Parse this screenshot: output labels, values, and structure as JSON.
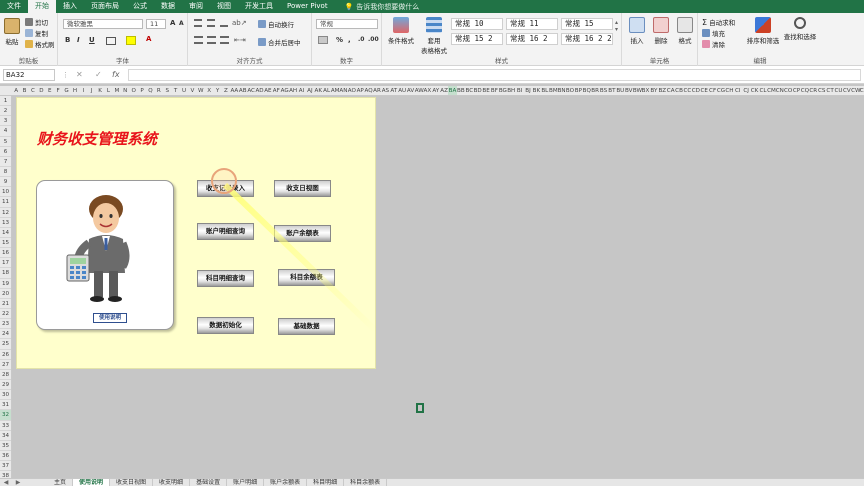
{
  "menubar": {
    "items": [
      "文件",
      "开始",
      "插入",
      "页面布局",
      "公式",
      "数据",
      "审阅",
      "视图",
      "开发工具",
      "Power Pivot"
    ],
    "active_index": 1,
    "tell_me": "告诉我你想要做什么"
  },
  "ribbon": {
    "clipboard": {
      "paste": "粘贴",
      "cut": "剪切",
      "copy": "复制",
      "format_painter": "格式刷",
      "label": "剪贴板"
    },
    "font": {
      "font_name": "微软雅黑",
      "font_size": "11",
      "bold": "B",
      "italic": "I",
      "underline": "U",
      "label": "字体",
      "font_color": "#c00000"
    },
    "alignment": {
      "wrap_text": "自动换行",
      "merge_center": "合并后居中",
      "label": "对齐方式"
    },
    "number": {
      "format": "常规",
      "percent": "%",
      "label": "数字"
    },
    "styles": {
      "conditional": "条件格式",
      "table_format_line1": "套用",
      "table_format_line2": "表格格式",
      "cells": [
        "常规 10",
        "常规 11",
        "常规 15",
        "常规 15 2",
        "常规 16 2",
        "常规 16 2 2"
      ],
      "label": "样式"
    },
    "cells_group": {
      "insert": "插入",
      "delete": "删除",
      "format": "格式",
      "label": "单元格"
    },
    "editing": {
      "autosum": "自动求和",
      "fill": "填充",
      "clear": "清除",
      "sort_filter": "排序和筛选",
      "find_select": "查找和选择",
      "label": "编辑"
    }
  },
  "formula_bar": {
    "name_box": "BA32",
    "fx": "fx",
    "content": ""
  },
  "columns": [
    "A",
    "B",
    "C",
    "D",
    "E",
    "F",
    "G",
    "H",
    "I",
    "J",
    "K",
    "L",
    "M",
    "N",
    "O",
    "P",
    "Q",
    "R",
    "S",
    "T",
    "U",
    "V",
    "W",
    "X",
    "Y",
    "Z",
    "AA",
    "AB",
    "AC",
    "AD",
    "AE",
    "AF",
    "AG",
    "AH",
    "AI",
    "AJ",
    "AK",
    "AL",
    "AM",
    "AN",
    "AO",
    "AP",
    "AQ",
    "AR",
    "AS",
    "AT",
    "AU",
    "AV",
    "AW",
    "AX",
    "AY",
    "AZ",
    "BA",
    "BB",
    "BC",
    "BD",
    "BE",
    "BF",
    "BG",
    "BH",
    "BI",
    "BJ",
    "BK",
    "BL",
    "BM",
    "BN",
    "BO",
    "BP",
    "BQ",
    "BR",
    "BS",
    "BT",
    "BU",
    "BV",
    "BW",
    "BX",
    "BY",
    "BZ",
    "CA",
    "CB",
    "CC",
    "CD",
    "CE",
    "CF",
    "CG",
    "CH",
    "CI",
    "CJ",
    "CK",
    "CL",
    "CM",
    "CN",
    "CO",
    "CP",
    "CQ",
    "CR",
    "CS",
    "CT",
    "CU",
    "CV",
    "CW",
    "CX",
    "CY",
    "CZ",
    "DA",
    "DB",
    "DC",
    "DD",
    "DE"
  ],
  "selected_column": "BA",
  "rows": [
    "1",
    "2",
    "3",
    "4",
    "5",
    "6",
    "7",
    "8",
    "9",
    "10",
    "11",
    "12",
    "13",
    "14",
    "15",
    "16",
    "17",
    "18",
    "19",
    "20",
    "21",
    "22",
    "23",
    "24",
    "25",
    "26",
    "27",
    "28",
    "29",
    "30",
    "31",
    "32",
    "33",
    "34",
    "35",
    "36",
    "37",
    "38"
  ],
  "selected_row": "32",
  "dashboard": {
    "title": "财务收支管理系统",
    "manual_button": "使用说明",
    "buttons": [
      {
        "label": "收支记录录入",
        "name": "income-entry-button"
      },
      {
        "label": "收支日视图",
        "name": "daily-view-button"
      },
      {
        "label": "账户明细查询",
        "name": "account-detail-button"
      },
      {
        "label": "账户余额表",
        "name": "account-balance-button"
      },
      {
        "label": "科目明细查询",
        "name": "subject-detail-button"
      },
      {
        "label": "科目余额表",
        "name": "subject-balance-button"
      },
      {
        "label": "数据初始化",
        "name": "data-init-button"
      },
      {
        "label": "基础数据",
        "name": "base-data-button"
      }
    ]
  },
  "sheet_tabs": {
    "tabs": [
      "主页",
      "使用说明",
      "收支日视图",
      "收支明细",
      "基础设置",
      "账户明细",
      "账户余额表",
      "科目明细",
      "科目余额表"
    ],
    "active_index": 1
  }
}
